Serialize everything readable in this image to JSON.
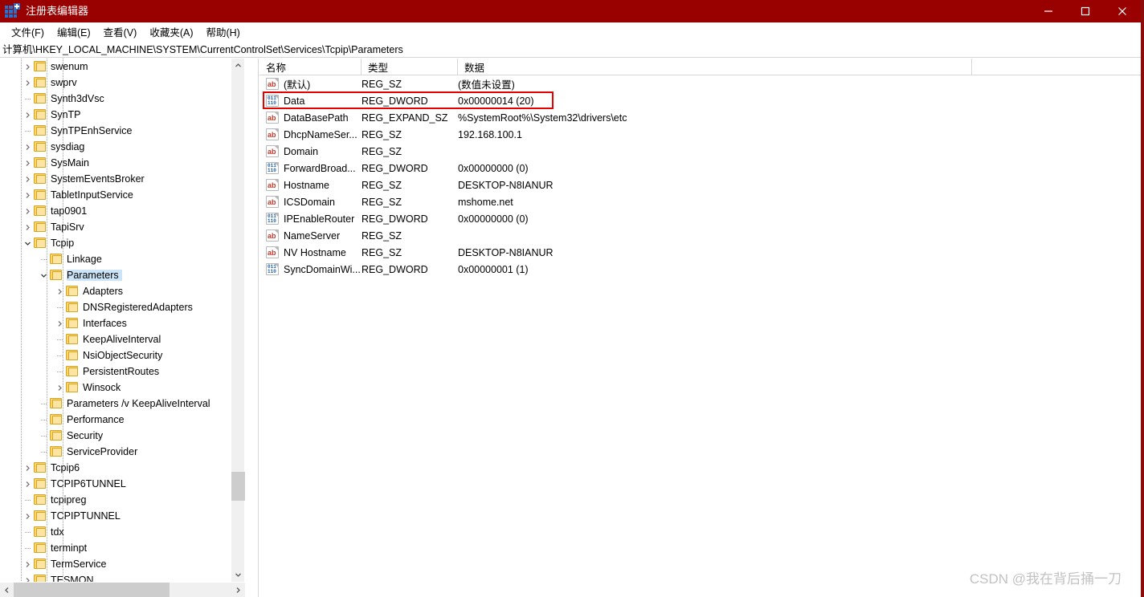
{
  "window": {
    "title": "注册表编辑器",
    "icon": "registry-editor-icon",
    "titlebar_color": "#990000",
    "controls": {
      "minimize": "minimize-icon",
      "maximize": "maximize-icon",
      "close": "close-icon"
    }
  },
  "menubar": {
    "items": [
      {
        "label": "文件(F)"
      },
      {
        "label": "编辑(E)"
      },
      {
        "label": "查看(V)"
      },
      {
        "label": "收藏夹(A)"
      },
      {
        "label": "帮助(H)"
      }
    ]
  },
  "address": {
    "path": "计算机\\HKEY_LOCAL_MACHINE\\SYSTEM\\CurrentControlSet\\Services\\Tcpip\\Parameters"
  },
  "tree": {
    "items": [
      {
        "label": "swenum",
        "depth": 2,
        "expander": "collapsed",
        "selected": false
      },
      {
        "label": "swprv",
        "depth": 2,
        "expander": "collapsed",
        "selected": false
      },
      {
        "label": "Synth3dVsc",
        "depth": 2,
        "expander": "none",
        "selected": false
      },
      {
        "label": "SynTP",
        "depth": 2,
        "expander": "collapsed",
        "selected": false
      },
      {
        "label": "SynTPEnhService",
        "depth": 2,
        "expander": "none",
        "selected": false
      },
      {
        "label": "sysdiag",
        "depth": 2,
        "expander": "collapsed",
        "selected": false
      },
      {
        "label": "SysMain",
        "depth": 2,
        "expander": "collapsed",
        "selected": false
      },
      {
        "label": "SystemEventsBroker",
        "depth": 2,
        "expander": "collapsed",
        "selected": false
      },
      {
        "label": "TabletInputService",
        "depth": 2,
        "expander": "collapsed",
        "selected": false
      },
      {
        "label": "tap0901",
        "depth": 2,
        "expander": "collapsed",
        "selected": false
      },
      {
        "label": "TapiSrv",
        "depth": 2,
        "expander": "collapsed",
        "selected": false
      },
      {
        "label": "Tcpip",
        "depth": 2,
        "expander": "expanded",
        "selected": false
      },
      {
        "label": "Linkage",
        "depth": 3,
        "expander": "none",
        "selected": false
      },
      {
        "label": "Parameters",
        "depth": 3,
        "expander": "expanded",
        "selected": true
      },
      {
        "label": "Adapters",
        "depth": 4,
        "expander": "collapsed",
        "selected": false
      },
      {
        "label": "DNSRegisteredAdapters",
        "depth": 4,
        "expander": "none",
        "selected": false
      },
      {
        "label": "Interfaces",
        "depth": 4,
        "expander": "collapsed",
        "selected": false
      },
      {
        "label": "KeepAliveInterval",
        "depth": 4,
        "expander": "none",
        "selected": false
      },
      {
        "label": "NsiObjectSecurity",
        "depth": 4,
        "expander": "none",
        "selected": false
      },
      {
        "label": "PersistentRoutes",
        "depth": 4,
        "expander": "none",
        "selected": false
      },
      {
        "label": "Winsock",
        "depth": 4,
        "expander": "collapsed",
        "selected": false
      },
      {
        "label": "Parameters /v KeepAliveInterval",
        "depth": 3,
        "expander": "none",
        "selected": false
      },
      {
        "label": "Performance",
        "depth": 3,
        "expander": "none",
        "selected": false
      },
      {
        "label": "Security",
        "depth": 3,
        "expander": "none",
        "selected": false
      },
      {
        "label": "ServiceProvider",
        "depth": 3,
        "expander": "none",
        "selected": false
      },
      {
        "label": "Tcpip6",
        "depth": 2,
        "expander": "collapsed",
        "selected": false
      },
      {
        "label": "TCPIP6TUNNEL",
        "depth": 2,
        "expander": "collapsed",
        "selected": false
      },
      {
        "label": "tcpipreg",
        "depth": 2,
        "expander": "none",
        "selected": false
      },
      {
        "label": "TCPIPTUNNEL",
        "depth": 2,
        "expander": "collapsed",
        "selected": false
      },
      {
        "label": "tdx",
        "depth": 2,
        "expander": "none",
        "selected": false
      },
      {
        "label": "terminpt",
        "depth": 2,
        "expander": "none",
        "selected": false
      },
      {
        "label": "TermService",
        "depth": 2,
        "expander": "collapsed",
        "selected": false
      },
      {
        "label": "TESMON",
        "depth": 2,
        "expander": "collapsed",
        "selected": false
      }
    ],
    "scrollbar": {
      "up_arrow": "chevron-up-icon",
      "down_arrow": "chevron-down-icon",
      "left_arrow": "chevron-left-icon",
      "right_arrow": "chevron-right-icon"
    }
  },
  "values": {
    "columns": [
      {
        "label": "名称"
      },
      {
        "label": "类型"
      },
      {
        "label": "数据"
      }
    ],
    "rows": [
      {
        "icon": "string-value-icon",
        "name": "(默认)",
        "type": "REG_SZ",
        "data": "(数值未设置)",
        "highlighted": false
      },
      {
        "icon": "dword-value-icon",
        "name": "Data",
        "type": "REG_DWORD",
        "data": "0x00000014 (20)",
        "highlighted": true
      },
      {
        "icon": "string-value-icon",
        "name": "DataBasePath",
        "type": "REG_EXPAND_SZ",
        "data": "%SystemRoot%\\System32\\drivers\\etc",
        "highlighted": false
      },
      {
        "icon": "string-value-icon",
        "name": "DhcpNameSer...",
        "type": "REG_SZ",
        "data": "192.168.100.1",
        "highlighted": false
      },
      {
        "icon": "string-value-icon",
        "name": "Domain",
        "type": "REG_SZ",
        "data": "",
        "highlighted": false
      },
      {
        "icon": "dword-value-icon",
        "name": "ForwardBroad...",
        "type": "REG_DWORD",
        "data": "0x00000000 (0)",
        "highlighted": false
      },
      {
        "icon": "string-value-icon",
        "name": "Hostname",
        "type": "REG_SZ",
        "data": "DESKTOP-N8IANUR",
        "highlighted": false
      },
      {
        "icon": "string-value-icon",
        "name": "ICSDomain",
        "type": "REG_SZ",
        "data": "mshome.net",
        "highlighted": false
      },
      {
        "icon": "dword-value-icon",
        "name": "IPEnableRouter",
        "type": "REG_DWORD",
        "data": "0x00000000 (0)",
        "highlighted": false
      },
      {
        "icon": "string-value-icon",
        "name": "NameServer",
        "type": "REG_SZ",
        "data": "",
        "highlighted": false
      },
      {
        "icon": "string-value-icon",
        "name": "NV Hostname",
        "type": "REG_SZ",
        "data": "DESKTOP-N8IANUR",
        "highlighted": false
      },
      {
        "icon": "dword-value-icon",
        "name": "SyncDomainWi...",
        "type": "REG_DWORD",
        "data": "0x00000001 (1)",
        "highlighted": false
      }
    ],
    "highlight_color": "#e60000"
  },
  "watermark": {
    "text": "CSDN @我在背后捅一刀"
  }
}
